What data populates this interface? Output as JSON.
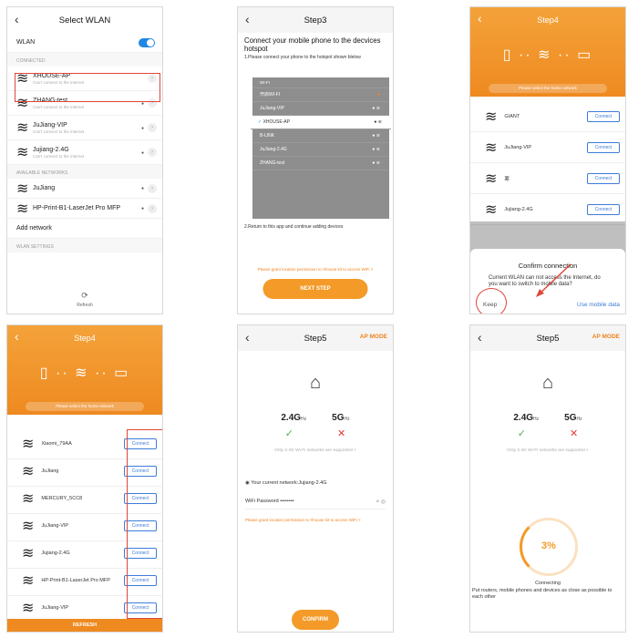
{
  "p1": {
    "title": "Select WLAN",
    "wlan_label": "WLAN",
    "section_connected": "CONNECTED",
    "section_available": "AVAILABLE NETWORKS",
    "section_settings": "WLAN SETTINGS",
    "connected": [
      {
        "name": "XHOUSE-AP",
        "sub": "Can't connect to the internet"
      },
      {
        "name": "ZHANG-test",
        "sub": "Can't connect to the internet"
      },
      {
        "name": "JuJiang-VIP",
        "sub": "Can't connect to the internet"
      },
      {
        "name": "Jujiang-2.4G",
        "sub": "Can't connect to the internet"
      }
    ],
    "available": [
      {
        "name": "JuJiang"
      },
      {
        "name": "HP-Print-B1-LaserJet Pro MFP"
      }
    ],
    "add_network": "Add network",
    "refresh": "Refresh"
  },
  "p2": {
    "title": "Step3",
    "heading": "Connect your mobile phone to the decvices hotspot",
    "instr1": "1.Please connect your phone to the hotspot shown blelow",
    "list": [
      "WI-FI",
      "开启WI-FI",
      "JuJiang-VIP",
      "XHOUSE-AP",
      "B-LINK",
      "JuJiang-2.4G",
      "ZHANG-test"
    ],
    "instr2": "2.Return to this app and continue adding devices",
    "perm": "Please grant location permission to Xhouse kit to access WiFi >",
    "next": "NEXT STEP"
  },
  "p3": {
    "title": "Step4",
    "hint": "Please select the home network",
    "list": [
      "GIANT",
      "JuJiang-VIP",
      "寒",
      "Jujiang-2.4G"
    ],
    "connect": "Connect",
    "dlg_title": "Confirm connection",
    "dlg_msg": "Current WLAN can not access the Internet, do you want to switch to mobile data?",
    "keep": "Keep",
    "use_mobile": "Use mobile data"
  },
  "p4": {
    "title": "Step4",
    "hint": "Please select the home network",
    "list": [
      "Xiaomi_79AA",
      "JuJiang",
      "MERCURY_5CC8",
      "JuJiang-VIP",
      "Jujiang-2.4G",
      "HP-Print-B1-LaserJet Pro MFP",
      "JuJiang-VIP"
    ],
    "connect": "Connect",
    "refresh": "REFRESH"
  },
  "p5": {
    "title": "Step5",
    "mode": "AP MODE",
    "band1": "2.4G",
    "band2": "5G",
    "hz": "Hz",
    "only": "Only 2.4G Wi-Fi networks are supported  >",
    "current": "Your current network:Jujiang-2.4G",
    "pw_label": "WiFi Password",
    "pw_value": "••••••••",
    "perm": "Please grant location permission to Xhouse kit to access WiFi >",
    "confirm": "CONFIRM"
  },
  "p6": {
    "title": "Step5",
    "mode": "AP MODE",
    "band1": "2.4G",
    "band2": "5G",
    "hz": "Hz",
    "only": "Only 2.4G Wi-Fi networks are supported  >",
    "percent": "3%",
    "progress": 0.03,
    "connecting": "Connecting",
    "tip": "Put routers, mobile phones and devices as close as possible to each other"
  }
}
